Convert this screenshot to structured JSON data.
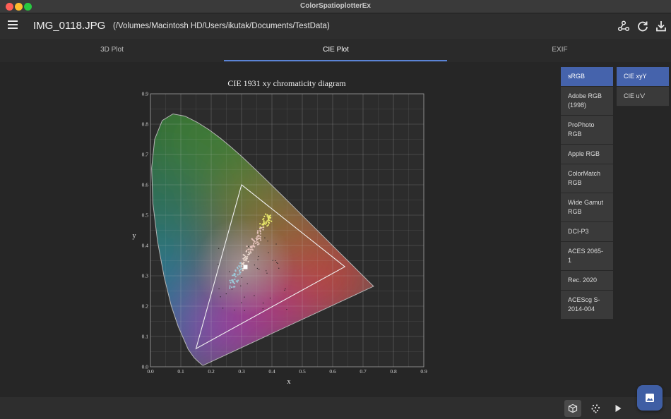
{
  "window": {
    "title": "ColorSpatioplotterEx"
  },
  "appbar": {
    "filename": "IMG_0118.JPG",
    "path": "(/Volumes/Macintosh HD/Users/ikutak/Documents/TestData)"
  },
  "tabs": [
    {
      "label": "3D Plot"
    },
    {
      "label": "CIE Plot"
    },
    {
      "label": "EXIF"
    }
  ],
  "active_tab": "CIE Plot",
  "gamuts": [
    {
      "label": "sRGB",
      "active": true
    },
    {
      "label": "Adobe RGB (1998)",
      "active": false
    },
    {
      "label": "ProPhoto RGB",
      "active": false
    },
    {
      "label": "Apple RGB",
      "active": false
    },
    {
      "label": "ColorMatch RGB",
      "active": false
    },
    {
      "label": "Wide Gamut RGB",
      "active": false
    },
    {
      "label": "DCI-P3",
      "active": false
    },
    {
      "label": "ACES 2065-1",
      "active": false
    },
    {
      "label": "Rec. 2020",
      "active": false
    },
    {
      "label": "ACEScg S-2014-004",
      "active": false
    }
  ],
  "color_spaces": [
    {
      "label": "CIE xyY",
      "active": true
    },
    {
      "label": "CIE u'v'",
      "active": false
    }
  ],
  "icons": {
    "menu": "menu-icon",
    "share": "share-icon",
    "refresh": "refresh-icon",
    "download": "download-icon",
    "cube": "cube-icon",
    "scatter": "scatter-icon",
    "play": "play-icon",
    "image": "image-icon"
  },
  "colors": {
    "accent": "#4563ac",
    "tab_indicator": "#5b84d6"
  },
  "chart_data": {
    "type": "scatter",
    "title": "CIE 1931 xy chromaticity diagram",
    "xlabel": "x",
    "ylabel": "y",
    "xlim": [
      0.0,
      0.9
    ],
    "ylim": [
      0.0,
      0.9
    ],
    "xticks": [
      "0.0",
      "0.1",
      "0.2",
      "0.3",
      "0.4",
      "0.5",
      "0.6",
      "0.7",
      "0.8",
      "0.9"
    ],
    "yticks": [
      "0.0",
      "0.1",
      "0.2",
      "0.3",
      "0.4",
      "0.5",
      "0.6",
      "0.7",
      "0.8",
      "0.9"
    ],
    "grid": true,
    "spectral_locus": [
      [
        0.1741,
        0.005
      ],
      [
        0.1738,
        0.0049
      ],
      [
        0.1733,
        0.0048
      ],
      [
        0.1726,
        0.0048
      ],
      [
        0.1714,
        0.0051
      ],
      [
        0.1689,
        0.0069
      ],
      [
        0.1644,
        0.0109
      ],
      [
        0.1566,
        0.0177
      ],
      [
        0.144,
        0.0297
      ],
      [
        0.1241,
        0.0578
      ],
      [
        0.0913,
        0.1327
      ],
      [
        0.0687,
        0.2007
      ],
      [
        0.0454,
        0.295
      ],
      [
        0.0235,
        0.4127
      ],
      [
        0.0082,
        0.5384
      ],
      [
        0.0039,
        0.6548
      ],
      [
        0.0139,
        0.7502
      ],
      [
        0.0389,
        0.812
      ],
      [
        0.0743,
        0.8338
      ],
      [
        0.1142,
        0.8262
      ],
      [
        0.1547,
        0.8059
      ],
      [
        0.1929,
        0.7816
      ],
      [
        0.2296,
        0.7543
      ],
      [
        0.2658,
        0.7243
      ],
      [
        0.3016,
        0.6923
      ],
      [
        0.3373,
        0.6589
      ],
      [
        0.3731,
        0.6245
      ],
      [
        0.4087,
        0.5896
      ],
      [
        0.4441,
        0.5547
      ],
      [
        0.4788,
        0.5202
      ],
      [
        0.5125,
        0.4866
      ],
      [
        0.5448,
        0.4544
      ],
      [
        0.5752,
        0.4242
      ],
      [
        0.6029,
        0.3965
      ],
      [
        0.627,
        0.3725
      ],
      [
        0.6482,
        0.3514
      ],
      [
        0.6658,
        0.334
      ],
      [
        0.6801,
        0.3197
      ],
      [
        0.6915,
        0.3083
      ],
      [
        0.7006,
        0.2993
      ],
      [
        0.7079,
        0.292
      ],
      [
        0.714,
        0.2859
      ],
      [
        0.719,
        0.2809
      ],
      [
        0.723,
        0.277
      ],
      [
        0.726,
        0.274
      ],
      [
        0.7283,
        0.2717
      ],
      [
        0.73,
        0.27
      ],
      [
        0.7347,
        0.2653
      ]
    ],
    "gamut_triangle": [
      [
        0.64,
        0.33
      ],
      [
        0.3,
        0.6
      ],
      [
        0.15,
        0.06
      ]
    ],
    "white_point": [
      0.3127,
      0.329
    ]
  }
}
